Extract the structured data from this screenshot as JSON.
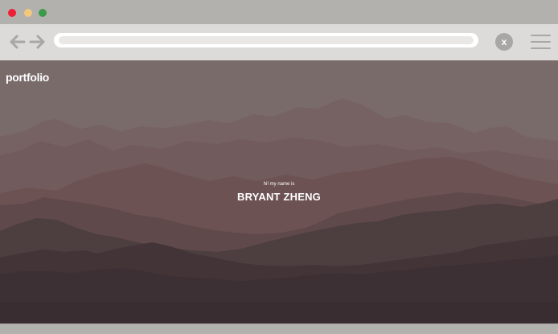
{
  "window": {
    "controls": [
      "close",
      "minimize",
      "maximize"
    ]
  },
  "toolbar": {
    "url_value": "",
    "close_label": "x"
  },
  "page": {
    "logo": "portfolio",
    "intro": "hi! my name is",
    "name": "BRYANT ZHENG"
  },
  "colors": {
    "sky": "#7b6b6b",
    "mountain_far": "#766363",
    "mountain_mid": "#6b5353",
    "mountain_near": "#4a3b3d",
    "mountain_front": "#3b2f33",
    "text": "#ffffff"
  }
}
